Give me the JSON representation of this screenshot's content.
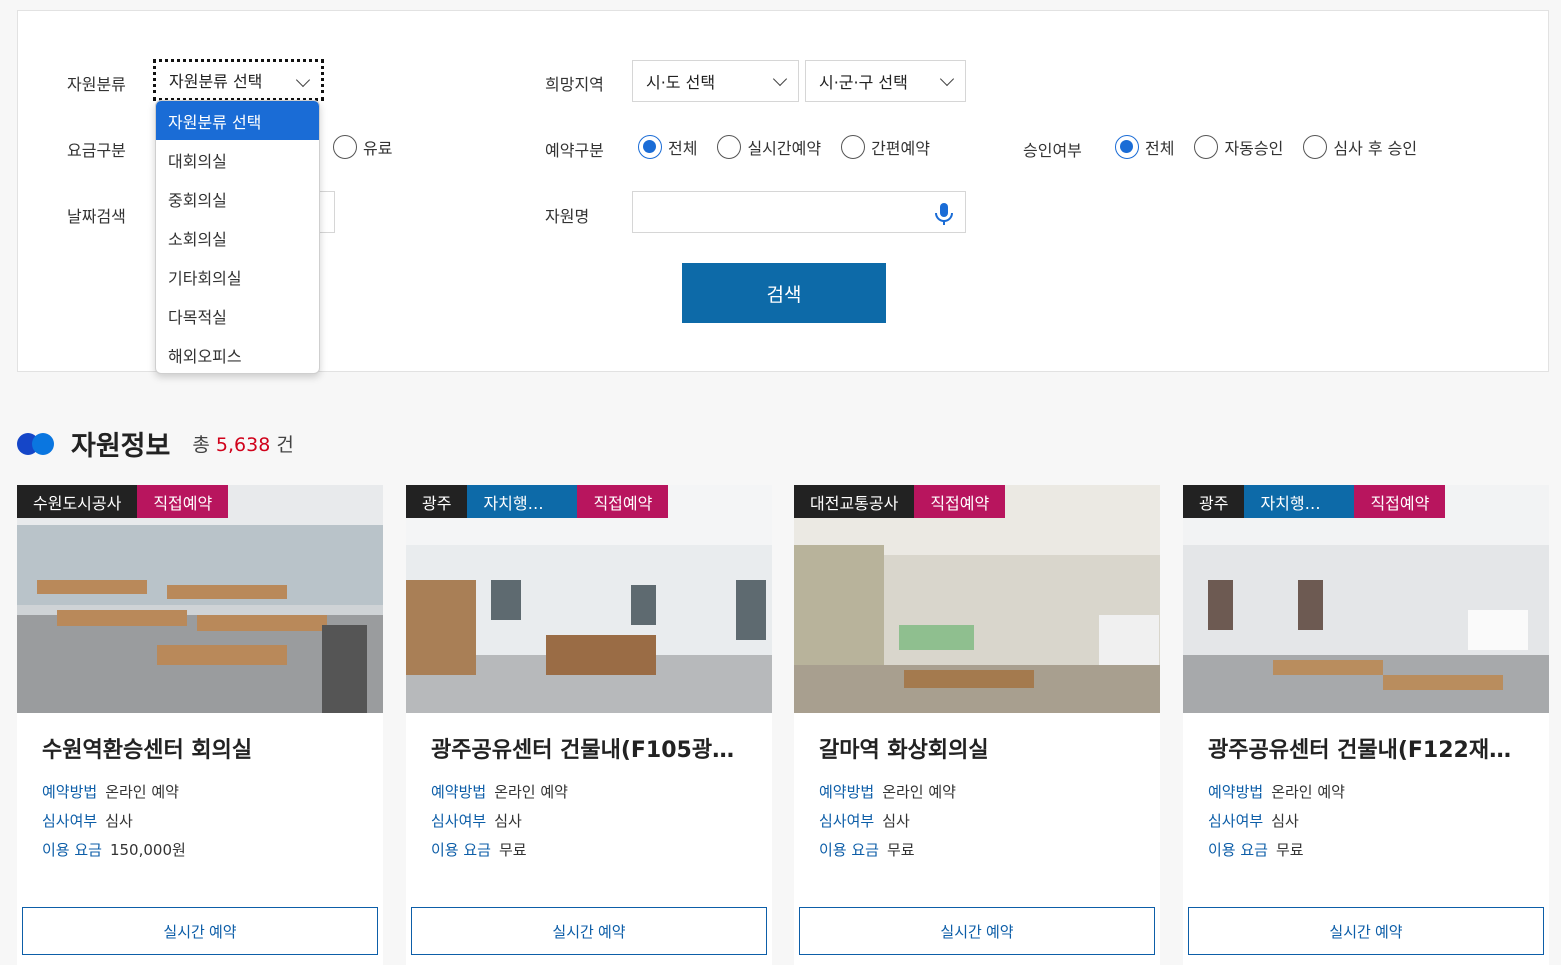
{
  "filters": {
    "resource_type_label": "자원분류",
    "resource_type_value": "자원분류 선택",
    "region_label": "희망지역",
    "region_sido": "시·도 선택",
    "region_sigungu": "시·군·구 선택",
    "fee_label": "요금구분",
    "fee_paid_option": "유료",
    "reservation_type_label": "예약구분",
    "reservation_options": [
      "전체",
      "실시간예약",
      "간편예약"
    ],
    "approval_label": "승인여부",
    "approval_options": [
      "전체",
      "자동승인",
      "심사 후 승인"
    ],
    "date_label": "날짜검색",
    "name_label": "자원명",
    "name_value": "",
    "search_button": "검색"
  },
  "dropdown": {
    "items": [
      "자원분류 선택",
      "대회의실",
      "중회의실",
      "소회의실",
      "기타회의실",
      "다목적실",
      "해외오피스"
    ],
    "selected": "자원분류 선택"
  },
  "section": {
    "title": "자원정보",
    "total_prefix": "총",
    "total_count": "5,638",
    "total_suffix": "건"
  },
  "cards": [
    {
      "tags": [
        "수원도시공사",
        "직접예약"
      ],
      "title": "수원역환승센터 회의실",
      "method_key": "예약방법",
      "method": "온라인 예약",
      "review_key": "심사여부",
      "review": "심사",
      "fee_key": "이용 요금",
      "fee": "150,000원",
      "button": "실시간 예약"
    },
    {
      "tags": [
        "광주",
        "자치행…",
        "직접예약"
      ],
      "title": "광주공유센터 건물내(F105광…",
      "method_key": "예약방법",
      "method": "온라인 예약",
      "review_key": "심사여부",
      "review": "심사",
      "fee_key": "이용 요금",
      "fee": "무료",
      "button": "실시간 예약"
    },
    {
      "tags": [
        "대전교통공사",
        "직접예약"
      ],
      "title": "갈마역 화상회의실",
      "method_key": "예약방법",
      "method": "온라인 예약",
      "review_key": "심사여부",
      "review": "심사",
      "fee_key": "이용 요금",
      "fee": "무료",
      "button": "실시간 예약"
    },
    {
      "tags": [
        "광주",
        "자치행…",
        "직접예약"
      ],
      "title": "광주공유센터 건물내(F122재…",
      "method_key": "예약방법",
      "method": "온라인 예약",
      "review_key": "심사여부",
      "review": "심사",
      "fee_key": "이용 요금",
      "fee": "무료",
      "button": "실시간 예약"
    }
  ],
  "colors": {
    "primary": "#0d6aa8",
    "radio_on": "#1a6cd6",
    "tag_pink": "#b8155e",
    "count_red": "#d0021b"
  },
  "icons": [
    "chevron-down-icon",
    "microphone-icon",
    "section-dots-icon"
  ]
}
